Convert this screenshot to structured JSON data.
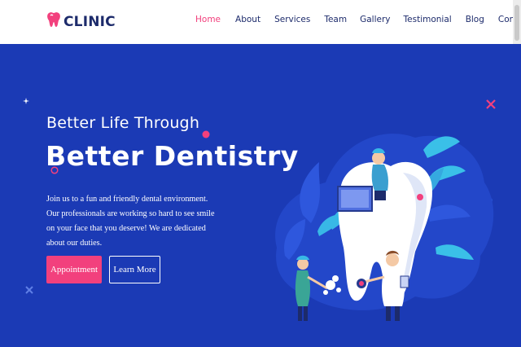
{
  "brand": {
    "name": "CLINIC",
    "logo_icon": "tooth-icon"
  },
  "nav": {
    "items": [
      {
        "label": "Home",
        "active": true
      },
      {
        "label": "About",
        "active": false
      },
      {
        "label": "Services",
        "active": false
      },
      {
        "label": "Team",
        "active": false
      },
      {
        "label": "Gallery",
        "active": false
      },
      {
        "label": "Testimonial",
        "active": false
      },
      {
        "label": "Blog",
        "active": false
      },
      {
        "label": "Contact",
        "active": false
      }
    ]
  },
  "hero": {
    "eyebrow": "Better Life Through",
    "headline": "Better Dentistry",
    "description": "Join us to a fun and friendly dental environment. Our professionals are working so hard to see smile on your face that you deserve! We are dedicated about our duties.",
    "primary_button": "Appointment",
    "secondary_button": "Learn More"
  },
  "colors": {
    "hero_background": "#1b3ab5",
    "accent": "#f2407d",
    "nav_text": "#1d2b6b",
    "white": "#ffffff"
  }
}
